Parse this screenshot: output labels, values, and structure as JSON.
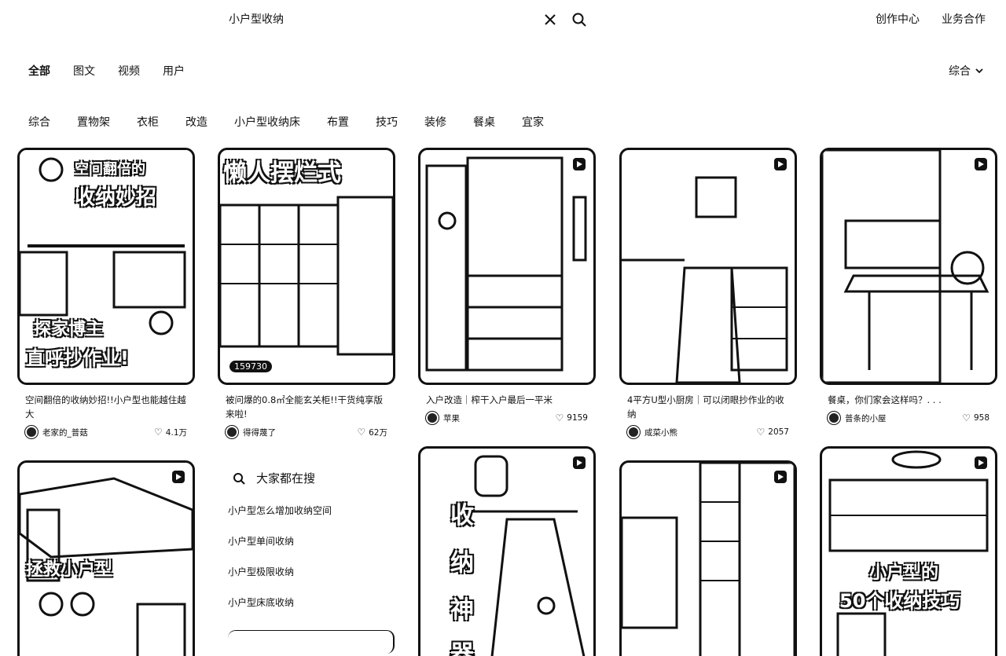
{
  "search": {
    "query": "小户型收纳"
  },
  "top_links": [
    "创作中心",
    "业务合作"
  ],
  "type_tabs": [
    "全部",
    "图文",
    "视频",
    "用户"
  ],
  "sort_label": "综合",
  "chips": [
    "综合",
    "置物架",
    "衣柜",
    "改造",
    "小户型收纳床",
    "布置",
    "技巧",
    "装修",
    "餐桌",
    "宜家"
  ],
  "cards": [
    {
      "title": "空间翻倍的收纳妙招!!小户型也能越住越大",
      "author": "老家的_普菇",
      "likes": "4.1万",
      "overlay": [
        "空间翻倍的",
        "收纳妙招",
        "探家博主",
        "直呼抄作业!"
      ]
    },
    {
      "title": "被问爆的0.8㎡全能玄关柜!!干货纯享版来啦!",
      "author": "得得蔑了",
      "likes": "62万",
      "overlay": [
        "懒人摆烂式"
      ],
      "views": "159730"
    },
    {
      "title": "入户改造｜榨干入户最后一平米",
      "author": "苹果",
      "likes": "9159"
    },
    {
      "title": "4平方U型小厨房｜可以闭眼抄作业的收纳",
      "author": "咸菜小熊",
      "likes": "2057"
    },
    {
      "title": "餐桌，你们家会这样吗？. . .",
      "author": "普条的小屋",
      "likes": "958"
    },
    {
      "overlay": [
        "拯救小户型"
      ]
    },
    {
      "overlay": [
        "收",
        "纳",
        "神",
        "器"
      ]
    },
    {},
    {
      "overlay": [
        "小户型的",
        "50个收纳技巧"
      ]
    }
  ],
  "trending": {
    "title": "大家都在搜",
    "items": [
      "小户型怎么增加收纳空间",
      "小户型单间收纳",
      "小户型极限收纳",
      "小户型床底收纳"
    ]
  }
}
